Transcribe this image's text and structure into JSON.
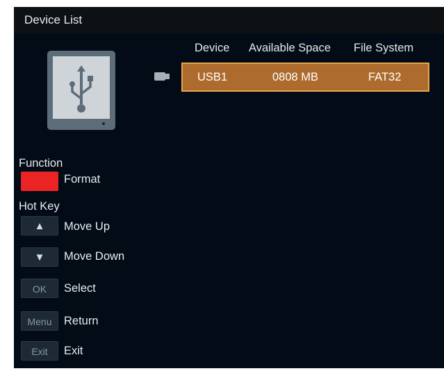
{
  "title": "Device List",
  "columns": [
    "Device",
    "Available Space",
    "File System"
  ],
  "rows": [
    {
      "device": "USB1",
      "space": "0808 MB",
      "fs": "FAT32",
      "selected": true
    }
  ],
  "function_section": {
    "heading": "Function",
    "items": [
      {
        "key_color": "#ea2424",
        "label": "Format"
      }
    ]
  },
  "hotkey_section": {
    "heading": "Hot Key",
    "items": [
      {
        "key": "▲",
        "label": "Move Up"
      },
      {
        "key": "▼",
        "label": "Move Down"
      },
      {
        "key": "OK",
        "label": "Select"
      },
      {
        "key": "Menu",
        "label": "Return"
      },
      {
        "key": "Exit",
        "label": "Exit"
      }
    ]
  },
  "colors": {
    "background": "#020b16",
    "selected_row": "#ad6c2e",
    "selected_border": "#e6a74e",
    "function_key": "#ea2424"
  },
  "icons": [
    "usb-device-icon",
    "usb-plug-icon"
  ]
}
